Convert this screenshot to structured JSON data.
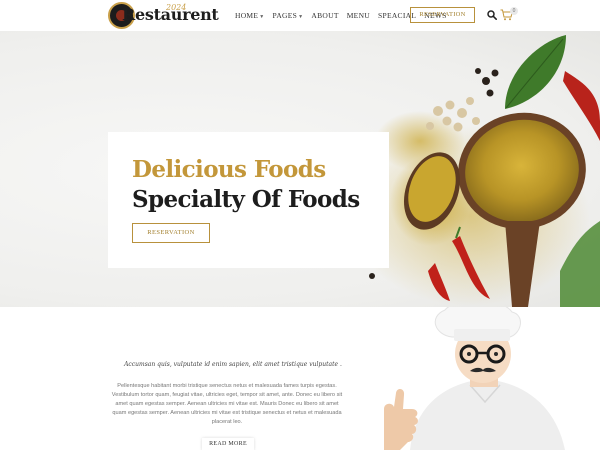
{
  "brand": {
    "name": "Restaurent",
    "script": "2024",
    "colors": {
      "gold": "#c3973a",
      "dark": "#1d1d1d",
      "chili": "#c0211a",
      "leaf": "#3f7a2a"
    }
  },
  "nav": {
    "items": [
      {
        "label": "HOME",
        "has_dropdown": true
      },
      {
        "label": "PAGES",
        "has_dropdown": true
      },
      {
        "label": "ABOUT",
        "has_dropdown": false
      },
      {
        "label": "MENU",
        "has_dropdown": false
      },
      {
        "label": "SPEACIAL",
        "has_dropdown": false
      },
      {
        "label": "NEWS",
        "has_dropdown": false
      }
    ],
    "reservation_label": "RESERVATION",
    "search_icon": "search-icon",
    "cart_icon": "cart-icon",
    "cart_count": "0"
  },
  "hero": {
    "title": "Delicious Foods",
    "subtitle": "Specialty Of Foods",
    "button_label": "RESERVATION"
  },
  "about": {
    "tagline": "Accumsan quis, vulputate id enim sapien, elit amet tristique vulputate .",
    "body": "Pellentesque habitant morbi tristique senectus netus et malesuada fames turpis egestas. Vestibulum tortor quam, feugiat vitae, ultricies eget, tempor sit amet, ante. Donec eu libero sit amet quam egestas semper. Aenean ultricies mi vitae est. Mauris Donec eu libero sit amet quam egestas semper. Aenean ultricies mi vitae est tristique senectus et netus et malesuada placerat leo.",
    "button_label": "READ MORE"
  }
}
